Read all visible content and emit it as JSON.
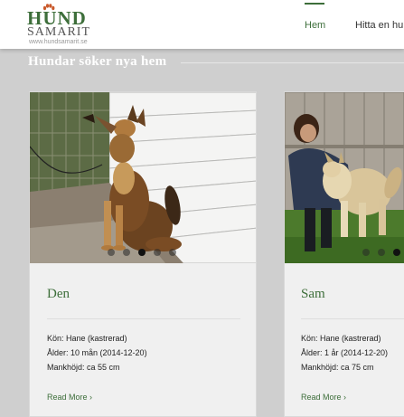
{
  "header": {
    "logo": {
      "brand": "HUND",
      "sub": "SAMARIT",
      "url": "www.hundsamarit.se",
      "icon": "paw-icon"
    },
    "nav": [
      {
        "label": "Hem",
        "active": true
      },
      {
        "label": "Hitta en hund",
        "active": false
      }
    ]
  },
  "section": {
    "title": "Hundar söker nya hem"
  },
  "dogs": [
    {
      "name": "Den",
      "gender": "Kön: Hane (kastrerad)",
      "age": "Ålder: 10 mån (2014-12-20)",
      "height": "Mankhöjd: ca 55 cm",
      "read_more": "Read More",
      "photo_count": 5,
      "active_photo": 3
    },
    {
      "name": "Sam",
      "gender": "Kön: Hane (kastrerad)",
      "age": "Ålder: 1 år (2014-12-20)",
      "height": "Mankhöjd: ca 75 cm",
      "read_more": "Read More",
      "photo_count": 5,
      "active_photo": 3
    }
  ],
  "colors": {
    "accent": "#3d6e3a",
    "background": "#cfcfcf",
    "card": "#f0f0f0"
  }
}
